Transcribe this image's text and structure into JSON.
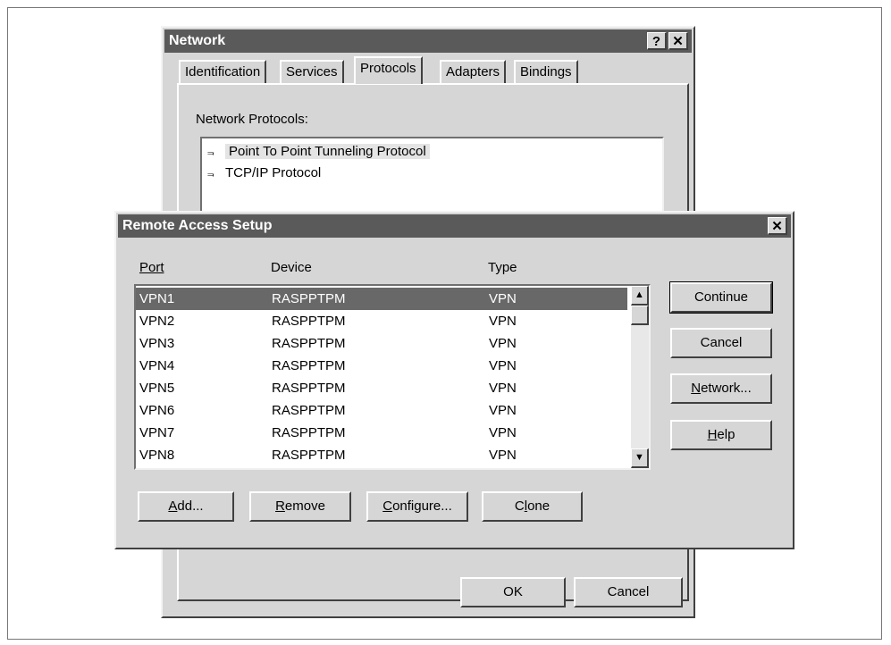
{
  "network_dialog": {
    "title": "Network",
    "help_btn": "?",
    "close_btn": "✕",
    "tabs": [
      "Identification",
      "Services",
      "Protocols",
      "Adapters",
      "Bindings"
    ],
    "protocols_label": "Network Protocols:",
    "protocols": [
      "Point To Point Tunneling Protocol",
      "TCP/IP Protocol"
    ],
    "ok_label": "OK",
    "cancel_label": "Cancel"
  },
  "ras_dialog": {
    "title": "Remote Access Setup",
    "close_btn": "✕",
    "columns": [
      "Port",
      "Device",
      "Type"
    ],
    "rows": [
      {
        "port": "VPN1",
        "device": "RASPPTPM",
        "type": "VPN"
      },
      {
        "port": "VPN2",
        "device": "RASPPTPM",
        "type": "VPN"
      },
      {
        "port": "VPN3",
        "device": "RASPPTPM",
        "type": "VPN"
      },
      {
        "port": "VPN4",
        "device": "RASPPTPM",
        "type": "VPN"
      },
      {
        "port": "VPN5",
        "device": "RASPPTPM",
        "type": "VPN"
      },
      {
        "port": "VPN6",
        "device": "RASPPTPM",
        "type": "VPN"
      },
      {
        "port": "VPN7",
        "device": "RASPPTPM",
        "type": "VPN"
      },
      {
        "port": "VPN8",
        "device": "RASPPTPM",
        "type": "VPN"
      }
    ],
    "side_buttons": [
      "Continue",
      "Cancel",
      "Network...",
      "Help"
    ],
    "bottom_buttons": [
      "Add...",
      "Remove",
      "Configure...",
      "Clone"
    ],
    "scroll_up": "▲",
    "scroll_down": "▼"
  }
}
